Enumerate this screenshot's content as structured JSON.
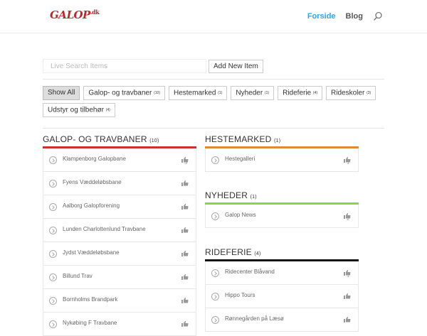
{
  "header": {
    "logo": "GALOP",
    "logo_suffix": ".dk",
    "nav": [
      "Forside",
      "Blog"
    ],
    "accent": "#2ea3f2"
  },
  "search": {
    "placeholder": "Live Search Items",
    "add_label": "Add New Item"
  },
  "filters": [
    {
      "label": "Show All",
      "count": ""
    },
    {
      "label": "Galop- og travbaner",
      "count": "(10)"
    },
    {
      "label": "Hestemarked",
      "count": "(1)"
    },
    {
      "label": "Nyheder",
      "count": "(1)"
    },
    {
      "label": "Rideferie",
      "count": "(4)"
    },
    {
      "label": "Rideskoler",
      "count": "(3)"
    },
    {
      "label": "Udstyr og tilbehør",
      "count": "(4)"
    }
  ],
  "categories": [
    {
      "title": "GALOP- OG TRAVBANER",
      "count": "(10)",
      "color": "#c93232",
      "items": [
        {
          "name": "Klampenborg Galopbane",
          "votes": "3"
        },
        {
          "name": "Fyens Væddeløbsbane",
          "votes": ""
        },
        {
          "name": "Aalborg Galopforening",
          "votes": ""
        },
        {
          "name": "Lunden Charlottenlund Travbane",
          "votes": ""
        },
        {
          "name": "Jydst Væddeløbsbane",
          "votes": ""
        },
        {
          "name": "Billund Trav",
          "votes": ""
        },
        {
          "name": "Bornholms Brandpark",
          "votes": ""
        },
        {
          "name": "Nykøbing F Travbane",
          "votes": ""
        }
      ]
    },
    {
      "title": "HESTEMARKED",
      "count": "(1)",
      "color": "#dd8a3a",
      "items": [
        {
          "name": "Hestegalleri",
          "votes": "1"
        }
      ]
    },
    {
      "title": "NYHEDER",
      "count": "(1)",
      "color": "#8fd14f",
      "items": [
        {
          "name": "Galop News",
          "votes": "2"
        }
      ]
    },
    {
      "title": "RIDEFERIE",
      "count": "(4)",
      "color": "#111111",
      "items": [
        {
          "name": "Ridecenter Blåvand",
          "votes": "1"
        },
        {
          "name": "Hippo Tours",
          "votes": ""
        },
        {
          "name": "Rønnegården på Læsø",
          "votes": ""
        }
      ]
    }
  ]
}
